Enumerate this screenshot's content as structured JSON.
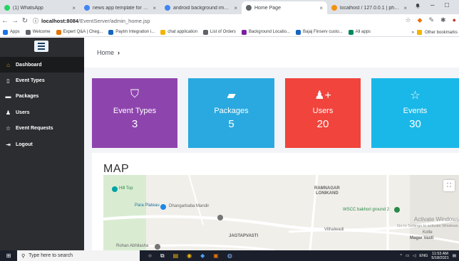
{
  "browser": {
    "tabs": [
      {
        "label": "(1) WhatsApp",
        "favicon_color": "#25d366",
        "active": false
      },
      {
        "label": "news app template for andro",
        "favicon_color": "#4285f4",
        "active": false
      },
      {
        "label": "android background image",
        "favicon_color": "#4285f4",
        "active": false
      },
      {
        "label": "Home Page",
        "favicon_color": "#5f6368",
        "active": true
      },
      {
        "label": "localhost / 127.0.0.1 | phpMy",
        "favicon_color": "#f29111",
        "active": false
      }
    ],
    "new_tab": "+",
    "window_controls": {
      "minimize": "–",
      "maximize": "□"
    },
    "url": {
      "host": "localhost:8084",
      "path": "/EventServer/admin_home.jsp"
    },
    "bookmarks": [
      {
        "label": "Apps",
        "color": "#1a73e8"
      },
      {
        "label": "Welcome",
        "color": "#5f6368"
      },
      {
        "label": "Expert Q&A | Cheg...",
        "color": "#e37400"
      },
      {
        "label": "Paytm Integration i...",
        "color": "#1565c0"
      },
      {
        "label": "chat application",
        "color": "#f4b400"
      },
      {
        "label": "List of Orders",
        "color": "#5f6368"
      },
      {
        "label": "Background Locatio...",
        "color": "#7b1fa2"
      },
      {
        "label": "Bajaj Finserv custo...",
        "color": "#1565c0"
      },
      {
        "label": "All apps",
        "color": "#01875f"
      }
    ],
    "bookmarks_more": "»",
    "other_bookmarks": "Other bookmarks"
  },
  "sidebar": {
    "items": [
      {
        "label": "Dashboard",
        "icon": "home-icon",
        "glyph": "⌂",
        "active": true
      },
      {
        "label": "Event Types",
        "icon": "bookmark-icon",
        "glyph": "▯",
        "active": false
      },
      {
        "label": "Packages",
        "icon": "briefcase-icon",
        "glyph": "▬",
        "active": false
      },
      {
        "label": "Users",
        "icon": "users-icon",
        "glyph": "♟",
        "active": false
      },
      {
        "label": "Event Requests",
        "icon": "star-icon",
        "glyph": "☆",
        "active": false
      },
      {
        "label": "Logout",
        "icon": "logout-icon",
        "glyph": "⇥",
        "active": false
      }
    ]
  },
  "breadcrumb": {
    "home": "Home",
    "separator": "›"
  },
  "cards": [
    {
      "label": "Event Types",
      "value": "3",
      "color": "#8e44ad",
      "icon": "bookmark-icon",
      "glyph": "⛉"
    },
    {
      "label": "Packages",
      "value": "5",
      "color": "#29a9e0",
      "icon": "briefcase-icon",
      "glyph": "▰"
    },
    {
      "label": "Users",
      "value": "20",
      "color": "#f0443c",
      "icon": "add-user-icon",
      "glyph": "♟+"
    },
    {
      "label": "Events",
      "value": "30",
      "color": "#1ab8e8",
      "icon": "star-icon",
      "glyph": "☆"
    }
  ],
  "map": {
    "title": "MAP",
    "labels": {
      "hill_top": "Hill Top",
      "para_plateau": "Para Plateau",
      "dhangarbaba": "Dhangarbaba Mandir",
      "ramnagar": "RAMNAGAR",
      "lonikand": "LONIKAND",
      "wscc": "WSCC bakhori ground 2",
      "vithalwadi": "Vithalwadi",
      "jagtapvasti": "JAGTAPVASTI",
      "rohan": "Rohan Abhilasha",
      "kolte": "Kolte",
      "magar_vasti": "Magar Vasti"
    },
    "watermark": "Activate Windows",
    "watermark_sub": "Go to Settings to activate Windows."
  },
  "taskbar": {
    "search_placeholder": "Type here to search",
    "language": "ENG",
    "time": "11:53 AM",
    "date": "5/18/2021"
  }
}
